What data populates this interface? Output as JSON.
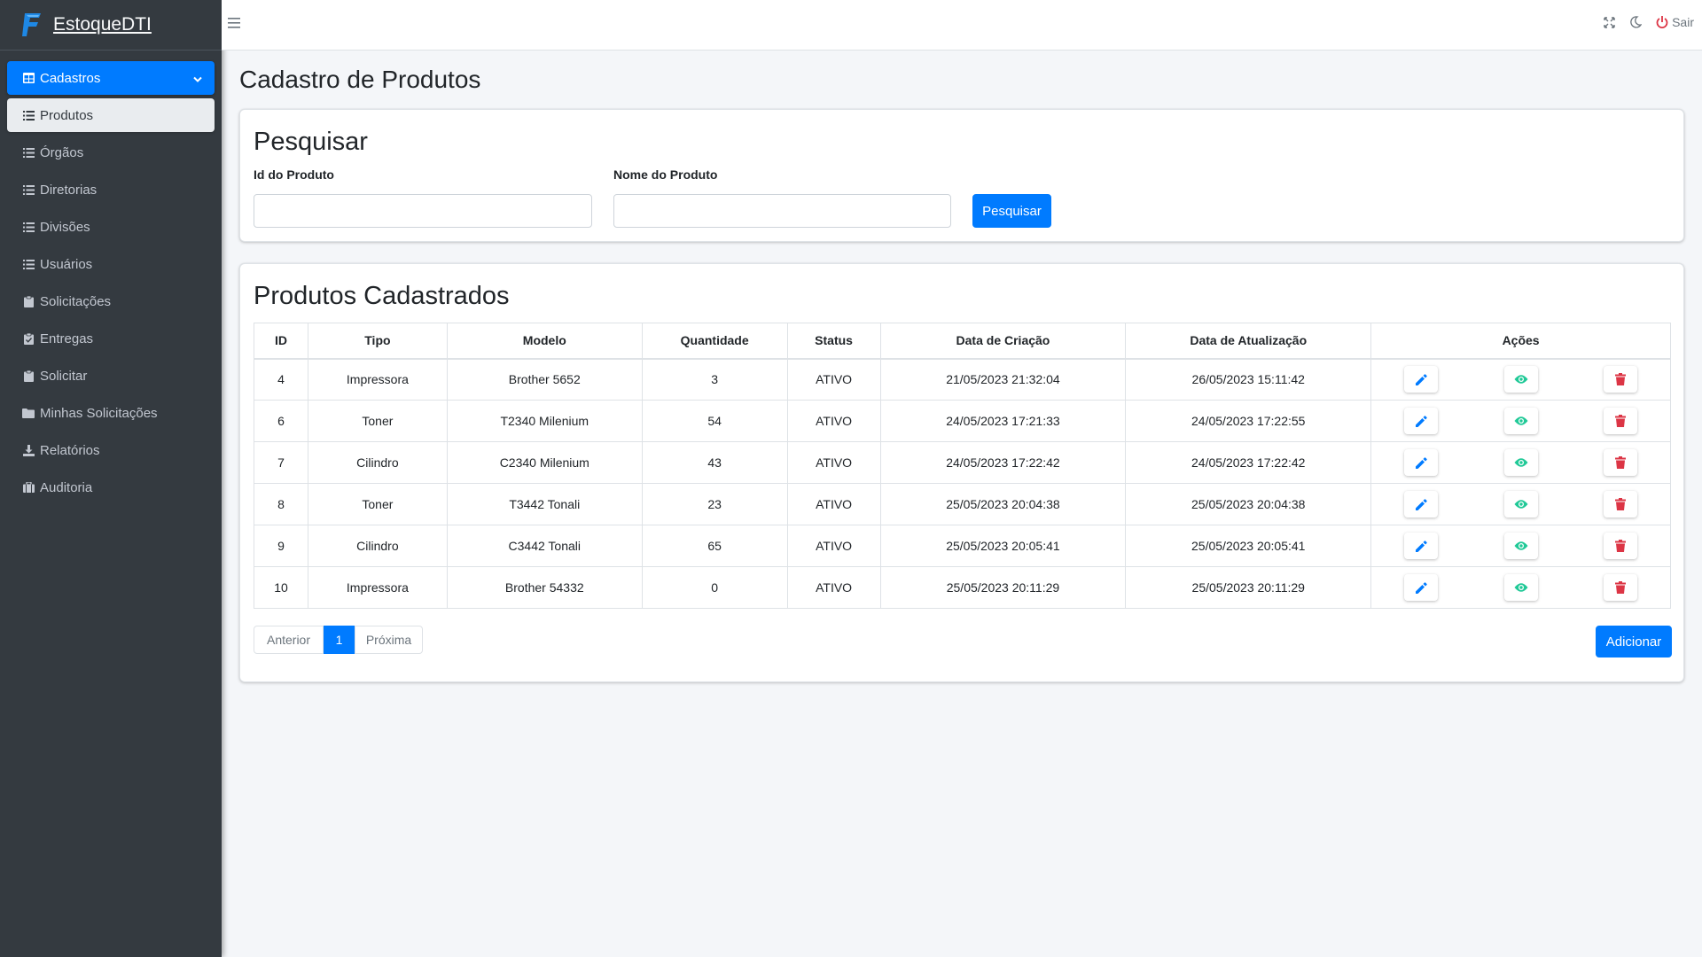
{
  "app": {
    "brand": "EstoqueDTI"
  },
  "topbar": {
    "logout_label": "Sair"
  },
  "sidebar": {
    "items": [
      {
        "label": "Cadastros",
        "icon": "table-icon"
      },
      {
        "label": "Produtos",
        "icon": "list-icon"
      },
      {
        "label": "Órgãos",
        "icon": "list-icon"
      },
      {
        "label": "Diretorias",
        "icon": "list-icon"
      },
      {
        "label": "Divisões",
        "icon": "list-icon"
      },
      {
        "label": "Usuários",
        "icon": "list-icon"
      },
      {
        "label": "Solicitações",
        "icon": "clipboard-icon"
      },
      {
        "label": "Entregas",
        "icon": "clipboard-check-icon"
      },
      {
        "label": "Solicitar",
        "icon": "clipboard-icon"
      },
      {
        "label": "Minhas Solicitações",
        "icon": "folder-icon"
      },
      {
        "label": "Relatórios",
        "icon": "download-icon"
      },
      {
        "label": "Auditoria",
        "icon": "briefcase-icon"
      }
    ]
  },
  "page": {
    "title": "Cadastro de Produtos"
  },
  "search": {
    "title": "Pesquisar",
    "id_label": "Id do Produto",
    "id_value": "",
    "name_label": "Nome do Produto",
    "name_value": "",
    "button": "Pesquisar"
  },
  "list": {
    "title": "Produtos Cadastrados",
    "headers": [
      "ID",
      "Tipo",
      "Modelo",
      "Quantidade",
      "Status",
      "Data de Criação",
      "Data de Atualização",
      "Ações"
    ],
    "rows": [
      [
        "4",
        "Impressora",
        "Brother 5652",
        "3",
        "ATIVO",
        "21/05/2023 21:32:04",
        "26/05/2023 15:11:42"
      ],
      [
        "6",
        "Toner",
        "T2340 Milenium",
        "54",
        "ATIVO",
        "24/05/2023 17:21:33",
        "24/05/2023 17:22:55"
      ],
      [
        "7",
        "Cilindro",
        "C2340 Milenium",
        "43",
        "ATIVO",
        "24/05/2023 17:22:42",
        "24/05/2023 17:22:42"
      ],
      [
        "8",
        "Toner",
        "T3442 Tonali",
        "23",
        "ATIVO",
        "25/05/2023 20:04:38",
        "25/05/2023 20:04:38"
      ],
      [
        "9",
        "Cilindro",
        "C3442 Tonali",
        "65",
        "ATIVO",
        "25/05/2023 20:05:41",
        "25/05/2023 20:05:41"
      ],
      [
        "10",
        "Impressora",
        "Brother 54332",
        "0",
        "ATIVO",
        "25/05/2023 20:11:29",
        "25/05/2023 20:11:29"
      ]
    ],
    "pagination": {
      "prev": "Anterior",
      "current": "1",
      "next": "Próxima"
    },
    "add_button": "Adicionar"
  },
  "colors": {
    "primary": "#007bff",
    "edit": "#007bff",
    "view": "#20c997",
    "delete": "#dc3545",
    "sidebar_bg": "#343a40",
    "logout": "#dc3545"
  }
}
